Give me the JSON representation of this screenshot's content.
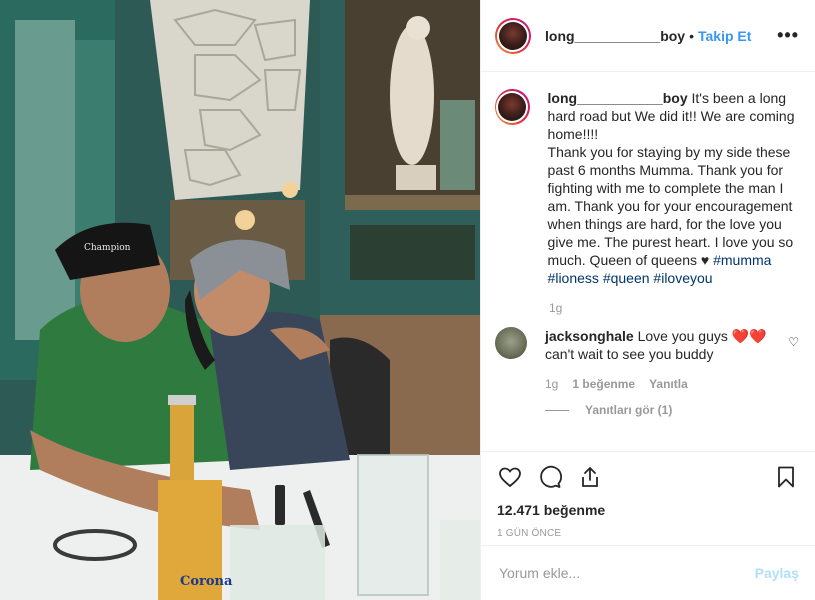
{
  "post": {
    "username": "long___________boy",
    "separator": "•",
    "follow_label": "Takip Et",
    "more_icon": "more-horizontal-icon"
  },
  "caption": {
    "username": "long___________boy",
    "text_before_hashtags": "It's been a long hard road but We did it!! We are coming home!!!!\nThank you for staying by my side these past 6 months Mumma. Thank you for fighting with me to complete the man I am. Thank you for your encouragement when things are hard, for the love you give me. The purest heart. I love you so much. Queen of queens ♥",
    "hashtags": [
      "#mumma",
      "#lioness",
      "#queen",
      "#iloveyou"
    ],
    "time": "1g"
  },
  "comments": [
    {
      "username": "jacksonghale",
      "text": "Love you guys ❤️❤️ can't wait to see you buddy",
      "time": "1g",
      "likes_label": "1 beğenme",
      "reply_label": "Yanıtla",
      "view_replies_label": "Yanıtları gör (1)"
    }
  ],
  "actions": {
    "like_icon": "heart-icon",
    "comment_icon": "comment-icon",
    "share_icon": "share-icon",
    "save_icon": "bookmark-icon",
    "likes_count": "12.471 beğenme",
    "posted_ago": "1 GÜN ÖNCE"
  },
  "add_comment": {
    "placeholder": "Yorum ekle...",
    "submit_label": "Paylaş"
  },
  "photo": {
    "cap_text": "Champion",
    "bottle_text": "Corona"
  },
  "colors": {
    "accent": "#3897f0",
    "hashtag": "#003569",
    "muted": "#999999",
    "submit_disabled": "#b2dffc"
  }
}
